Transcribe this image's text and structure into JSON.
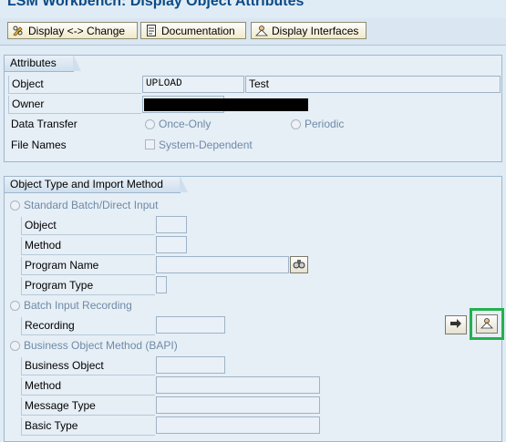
{
  "window": {
    "title": "LSM Workbench: Display Object Attributes"
  },
  "toolbar": {
    "display_change": "Display <-> Change",
    "documentation": "Documentation",
    "display_interfaces": "Display Interfaces"
  },
  "attributes": {
    "title": "Attributes",
    "object_label": "Object",
    "object_value": "UPLOAD",
    "object_desc": "Test",
    "owner_label": "Owner",
    "data_transfer_label": "Data Transfer",
    "once_only": "Once-Only",
    "periodic": "Periodic",
    "file_names_label": "File Names",
    "system_dependent": "System-Dependent"
  },
  "import_method": {
    "title": "Object Type and Import Method",
    "standard_batch": "Standard Batch/Direct Input",
    "object_label": "Object",
    "method_label": "Method",
    "program_name_label": "Program Name",
    "program_type_label": "Program Type",
    "batch_input_recording": "Batch Input Recording",
    "recording_label": "Recording",
    "bapi": "Business Object Method  (BAPI)",
    "business_object_label": "Business Object",
    "bapi_method_label": "Method",
    "message_type_label": "Message Type",
    "basic_type_label": "Basic Type"
  },
  "colors": {
    "highlight": "#23b14d",
    "title": "#0b4a86",
    "background": "#dfebf5"
  },
  "icons": [
    "pencil-glasses-icon",
    "document-icon",
    "person-icon",
    "binoculars-icon",
    "arrow-right-icon",
    "person-icon"
  ]
}
